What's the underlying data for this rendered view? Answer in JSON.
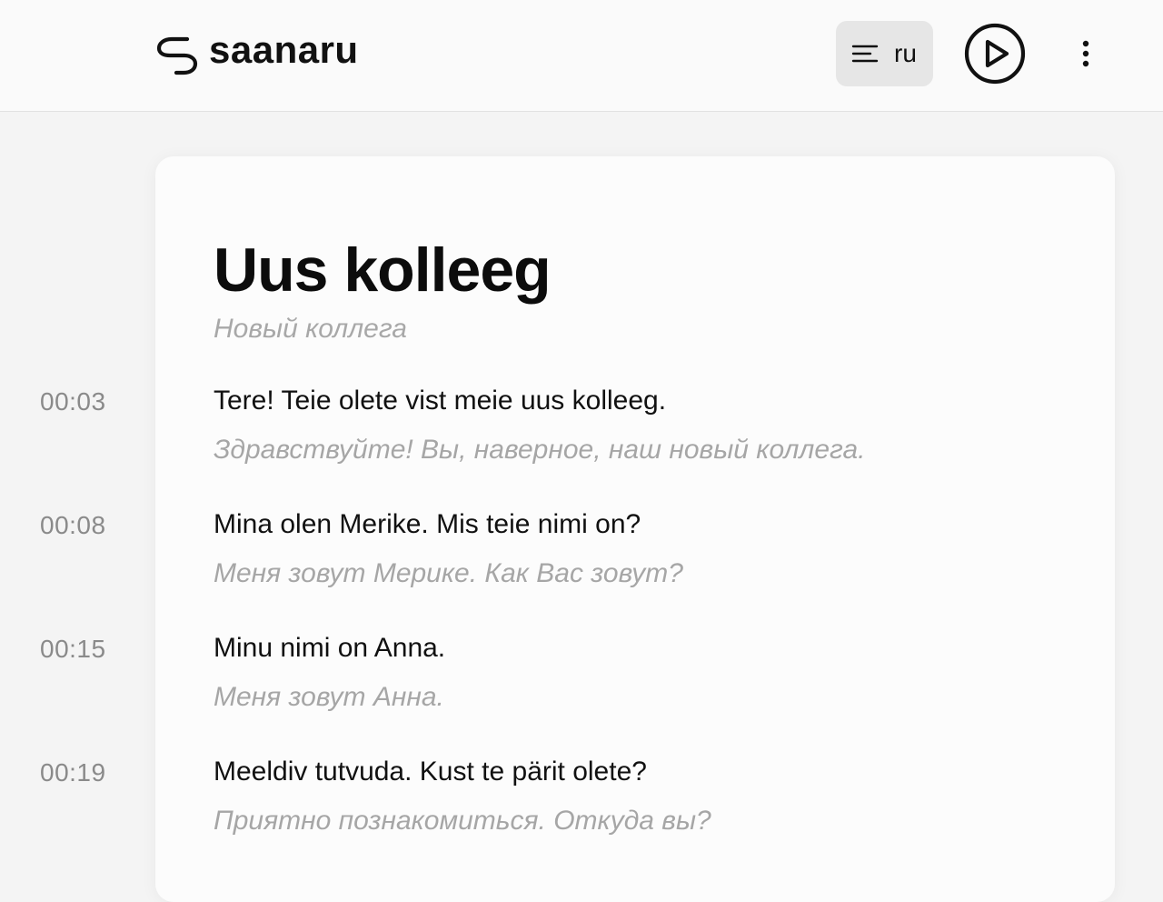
{
  "header": {
    "logo_text": "saanaru",
    "language_label": "ru",
    "play_label": "",
    "more_icon": "more-vertical-icon"
  },
  "lesson": {
    "title": "Uus kolleeg",
    "subtitle": "Новый коллега",
    "lines": [
      {
        "time": "00:03",
        "text": "Tere! Teie olete vist meie uus kolleeg.",
        "translation": "Здравствуйте! Вы, наверное, наш новый коллега."
      },
      {
        "time": "00:08",
        "text": "Mina olen Merike. Mis teie nimi on?",
        "translation": "Меня зовут Мерике. Как Вас зовут?"
      },
      {
        "time": "00:15",
        "text": "Minu nimi on Anna.",
        "translation": "Меня зовут Анна."
      },
      {
        "time": "00:19",
        "text": "Meeldiv tutvuda. Kust te pärit olete?",
        "translation": "Приятно познакомиться. Откуда вы?"
      }
    ]
  },
  "colors": {
    "background": "#f4f4f4",
    "card": "#fcfcfc",
    "text": "#111111",
    "muted": "#a6a6a6",
    "timestamp": "#8a8a8a"
  }
}
